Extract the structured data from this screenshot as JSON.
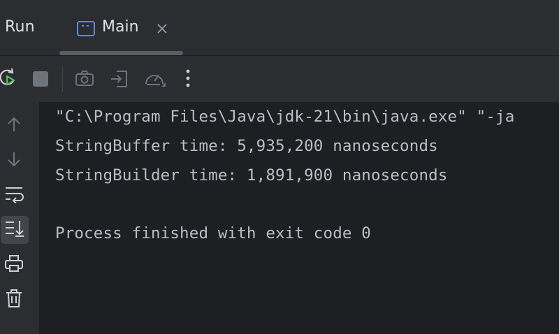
{
  "header": {
    "panel_title": "Run",
    "tab": {
      "label": "Main",
      "icon": "console-window-icon"
    }
  },
  "toolbar": {
    "buttons": [
      {
        "name": "rerun",
        "icon": "rerun-icon",
        "enabled": true
      },
      {
        "name": "stop",
        "icon": "stop-icon",
        "enabled": false
      },
      {
        "name": "dump-threads",
        "icon": "camera-icon",
        "enabled": false
      },
      {
        "name": "exit",
        "icon": "exit-icon",
        "enabled": false
      },
      {
        "name": "profiler",
        "icon": "gauge-icon",
        "enabled": false
      },
      {
        "name": "more",
        "icon": "kebab-menu-icon",
        "enabled": true
      }
    ]
  },
  "gutter": {
    "buttons": [
      {
        "name": "up",
        "icon": "arrow-up-icon",
        "active": false
      },
      {
        "name": "down",
        "icon": "arrow-down-icon",
        "active": false
      },
      {
        "name": "soft-wrap",
        "icon": "soft-wrap-icon",
        "active": false
      },
      {
        "name": "scroll-to-end",
        "icon": "scroll-to-end-icon",
        "active": true
      },
      {
        "name": "print",
        "icon": "printer-icon",
        "active": false
      },
      {
        "name": "clear",
        "icon": "trash-icon",
        "active": false
      }
    ]
  },
  "console": {
    "lines": [
      "\"C:\\Program Files\\Java\\jdk-21\\bin\\java.exe\" \"-ja",
      "StringBuffer time: 5,935,200 nanoseconds",
      "StringBuilder time: 1,891,900 nanoseconds",
      "",
      "Process finished with exit code 0"
    ]
  },
  "colors": {
    "background": "#1e1f22",
    "panel": "#2b2d30",
    "text": "#bcbec4",
    "icon_enabled": "#ced0d6",
    "icon_disabled": "#6f737a",
    "run_green": "#5fb865",
    "tab_icon_blue": "#548af7"
  }
}
